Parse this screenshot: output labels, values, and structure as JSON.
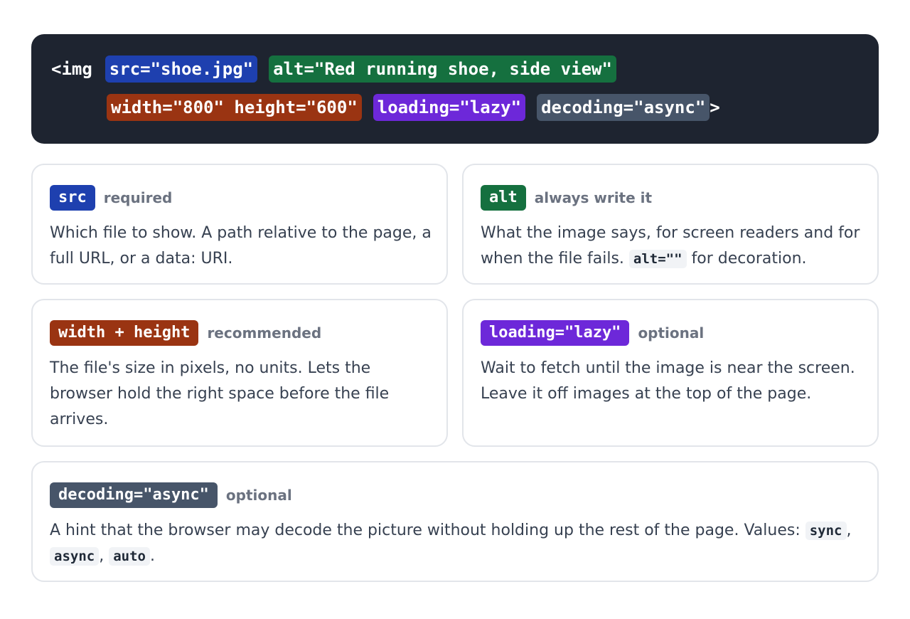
{
  "code": {
    "open": "<img",
    "close": ">",
    "attrs": {
      "src": "src=\"shoe.jpg\"",
      "alt": "alt=\"Red running shoe, side view\"",
      "size": "width=\"800\" height=\"600\"",
      "loading": "loading=\"lazy\"",
      "decoding": "decoding=\"async\""
    }
  },
  "cards": {
    "src": {
      "tag": "src",
      "note": "required",
      "text": "Which file to show. A path relative to the page, a full URL, or a data: URI."
    },
    "alt": {
      "tag": "alt",
      "note": "always write it",
      "text_before": "What the image says, for screen readers and for when the file fails.",
      "code": "alt=\"\"",
      "text_after": "for decoration."
    },
    "size": {
      "tag": "width + height",
      "note": "recommended",
      "text": "The file's size in pixels, no units. Lets the browser hold the right space before the file arrives."
    },
    "loading": {
      "tag": "loading=\"lazy\"",
      "note": "optional",
      "text": "Wait to fetch until the image is near the screen. Leave it off images at the top of the page."
    },
    "decoding": {
      "tag": "decoding=\"async\"",
      "note": "optional",
      "text": "A hint that the browser may decode the picture without holding up the rest of the page. Values:",
      "values": [
        "sync",
        "async",
        "auto"
      ],
      "sep": ",",
      "end": "."
    }
  },
  "colors": {
    "src": "#1e40af",
    "alt": "#15703f",
    "size": "#9a3412",
    "loading": "#6d28d9",
    "decoding": "#475569",
    "panel": "#1e2430"
  }
}
